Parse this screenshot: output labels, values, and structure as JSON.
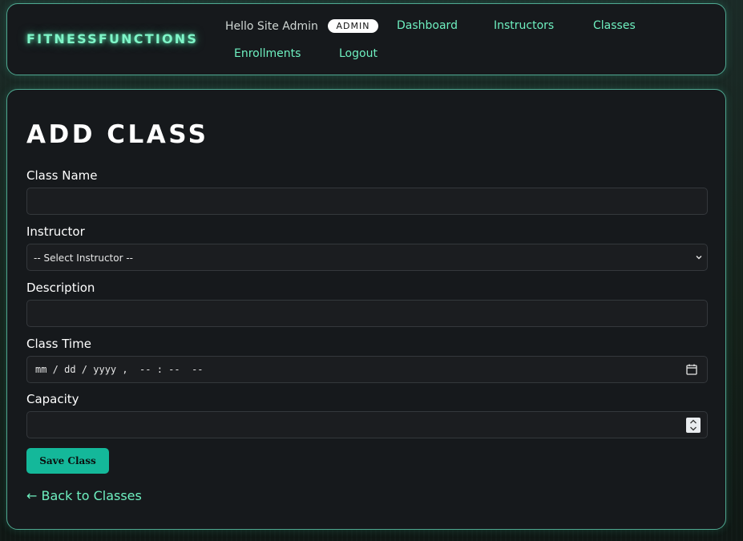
{
  "header": {
    "brand": "FITNESSFUNCTIONS",
    "greeting": "Hello Site Admin",
    "role_badge": "ADMIN",
    "nav": [
      {
        "label": "Dashboard"
      },
      {
        "label": "Instructors"
      },
      {
        "label": "Classes"
      },
      {
        "label": "Enrollments"
      },
      {
        "label": "Logout"
      }
    ]
  },
  "form": {
    "title": "ADD CLASS",
    "class_name": {
      "label": "Class Name",
      "value": ""
    },
    "instructor": {
      "label": "Instructor",
      "selected": "-- Select Instructor --"
    },
    "description": {
      "label": "Description",
      "value": ""
    },
    "class_time": {
      "label": "Class Time",
      "display": "mm / dd / yyyy ,  -- : --  --"
    },
    "capacity": {
      "label": "Capacity",
      "value": ""
    },
    "save_label": "Save Class",
    "back_label": "← Back to Classes"
  },
  "colors": {
    "accent": "#6ef0c0",
    "button": "#14b89a",
    "card_bg": "#16191c",
    "border": "#4fa891"
  }
}
